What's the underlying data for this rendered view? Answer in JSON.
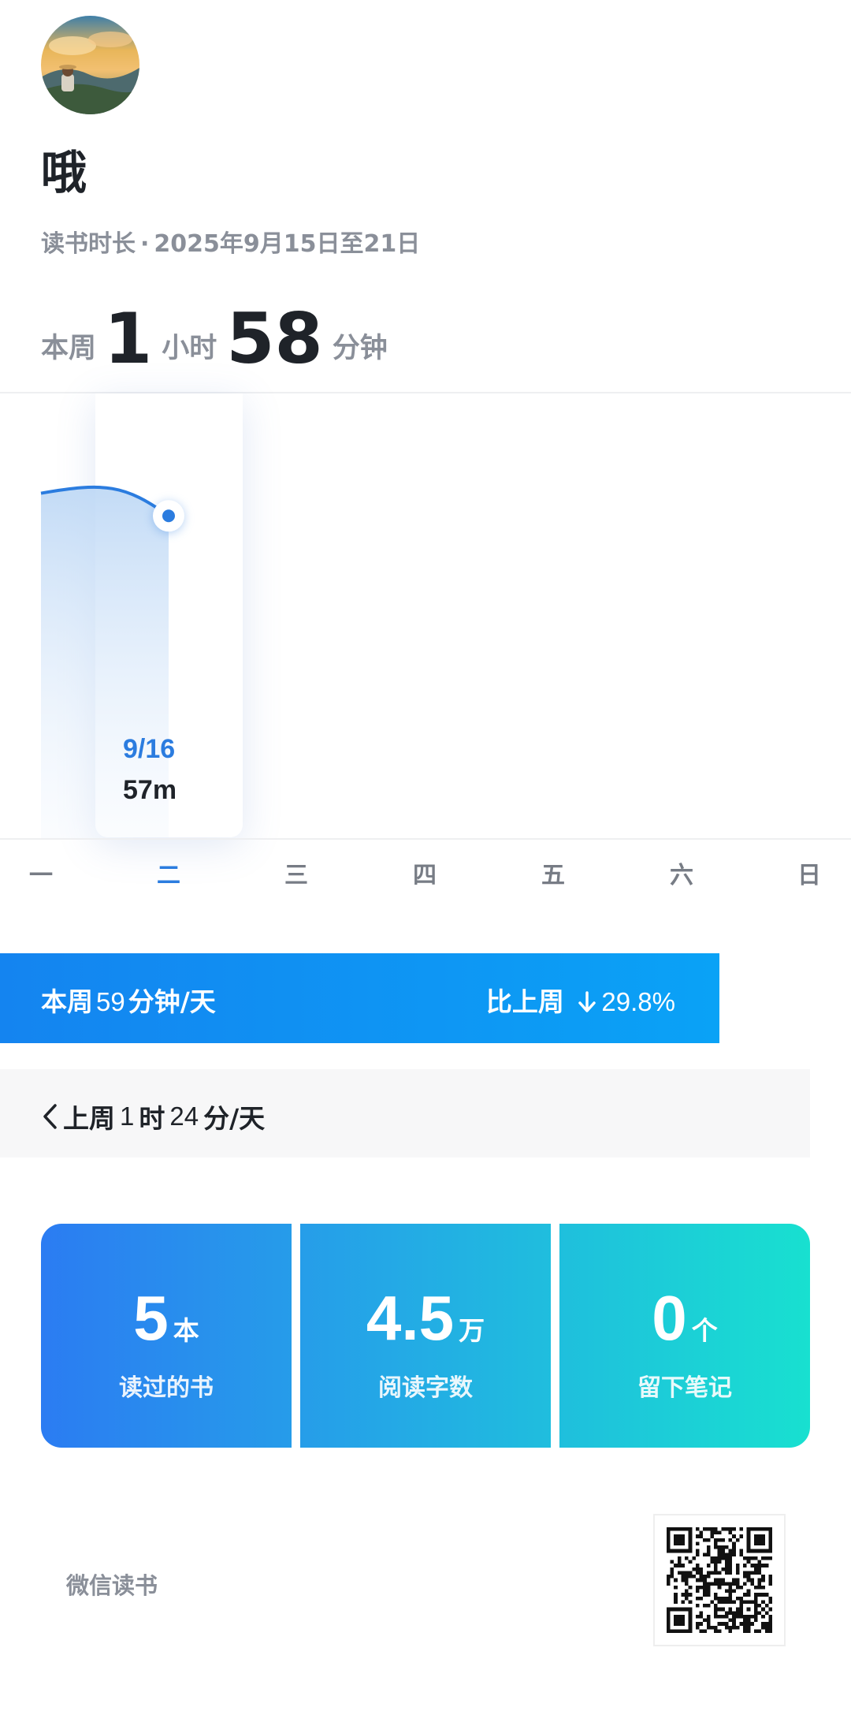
{
  "profile": {
    "avatar_icon": "avatar-landscape-icon",
    "username": "哦",
    "period_label": "读书时长",
    "period_separator": "·",
    "period_range": "2025年9月15日至21日"
  },
  "total": {
    "prefix": "本周",
    "hours": "1",
    "hours_unit": "小时",
    "minutes": "58",
    "minutes_unit": "分钟"
  },
  "chart_data": {
    "type": "area",
    "categories": [
      "一",
      "二",
      "三",
      "四",
      "五",
      "六",
      "日"
    ],
    "values_minutes": [
      61,
      57,
      null,
      null,
      null,
      null,
      null
    ],
    "selected": {
      "date": "9/16",
      "value": "57m"
    },
    "accent_color": "#2b7cdf"
  },
  "weekly": {
    "label": "本周",
    "value": "59",
    "unit": "分钟/天",
    "compare_label": "比上周",
    "compare_arrow_icon": "arrow-down-icon",
    "compare_value": "29.8%"
  },
  "last_week": {
    "chevron_icon": "chevron-left-icon",
    "label": "上周",
    "hours": "1",
    "hours_unit": "时",
    "minutes": "24",
    "minutes_unit": "分/天"
  },
  "stats": [
    {
      "value": "5",
      "unit": "本",
      "caption": "读过的书"
    },
    {
      "value": "4.5",
      "unit": "万",
      "caption": "阅读字数"
    },
    {
      "value": "0",
      "unit": "个",
      "caption": "留下笔记"
    }
  ],
  "footer": {
    "brand": "微信读书",
    "qr_icon": "qr-code-icon"
  }
}
